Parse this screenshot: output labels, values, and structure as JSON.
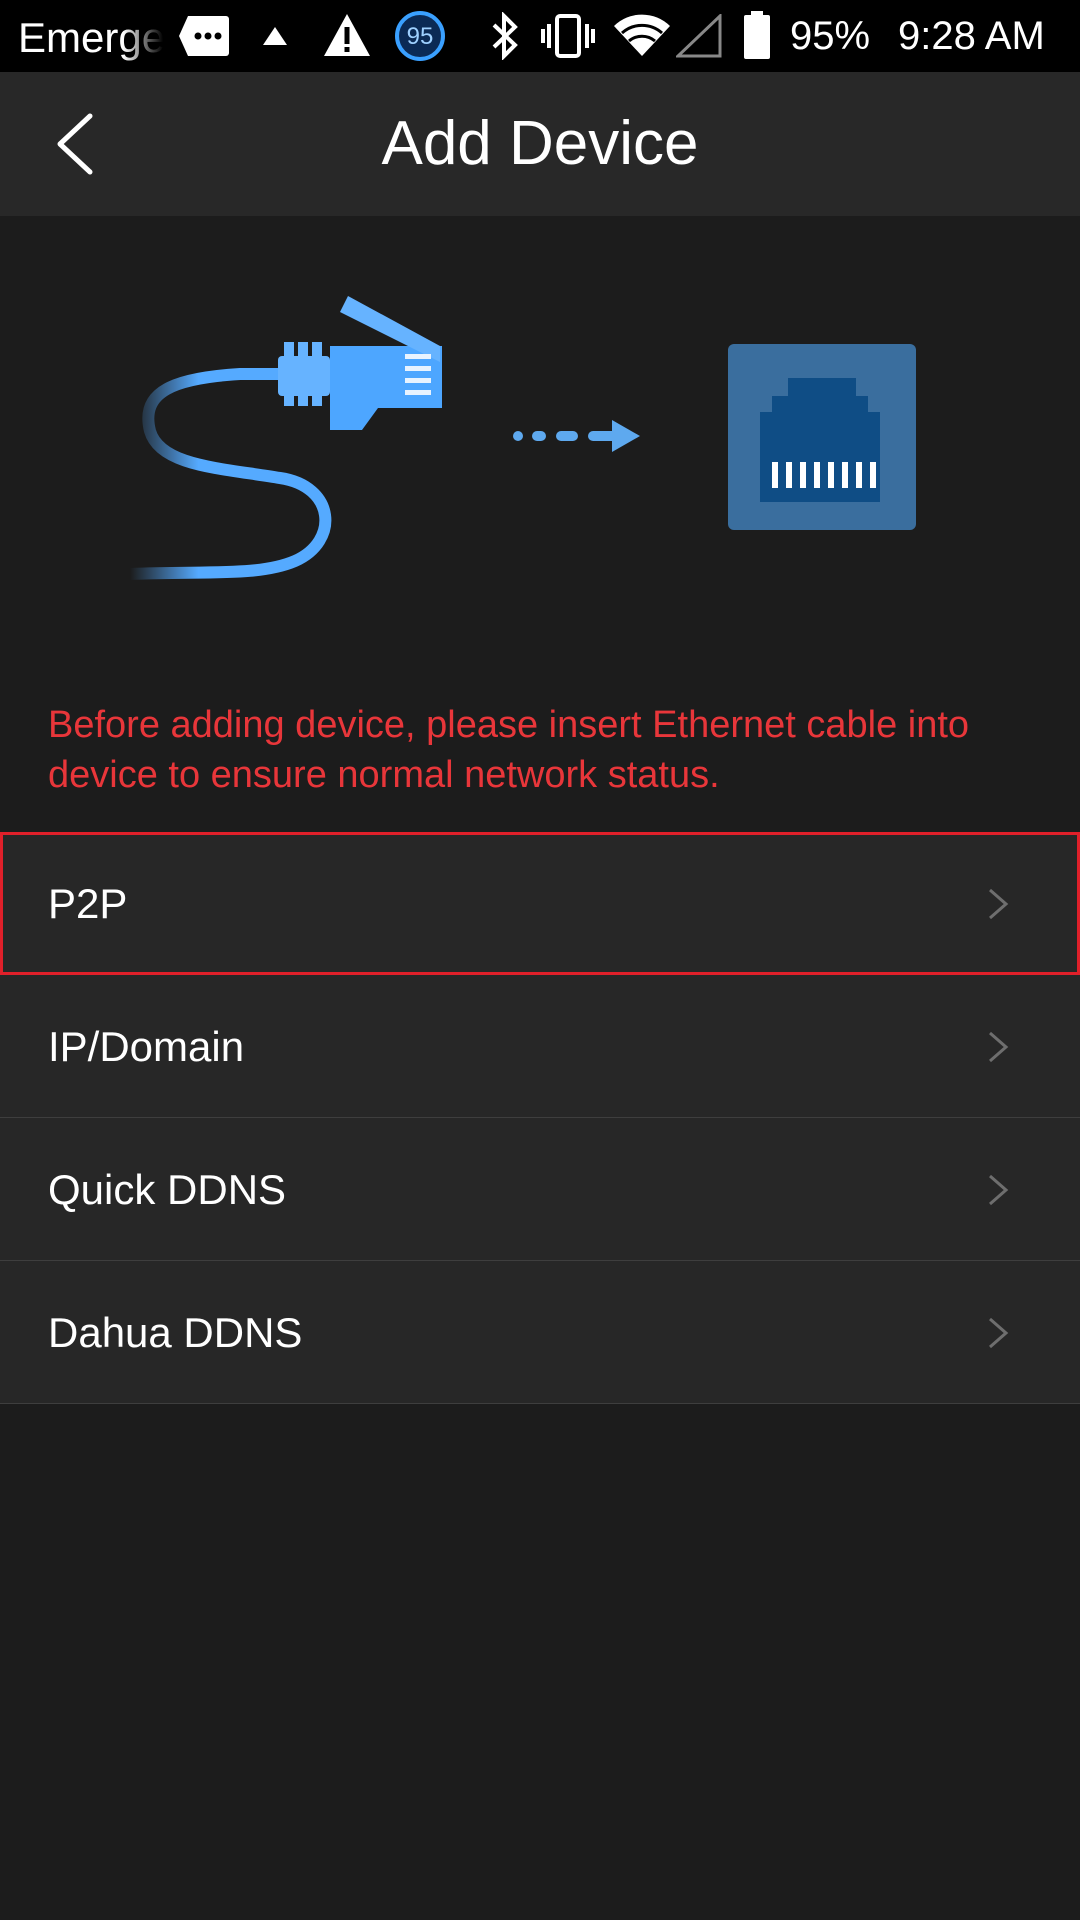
{
  "status_bar": {
    "carrier": "Emerge",
    "battery": "95%",
    "time": "9:28 AM",
    "badge_number": "95",
    "icons": [
      "message-icon",
      "upload-icon",
      "warning-icon",
      "badge-icon",
      "bluetooth-icon",
      "vibrate-icon",
      "wifi-icon",
      "signal-icon",
      "battery-icon"
    ]
  },
  "header": {
    "title": "Add Device",
    "back_icon": "back-arrow-icon"
  },
  "illustration": {
    "icons": [
      "ethernet-cable-icon",
      "arrow-right-icon",
      "ethernet-port-icon"
    ],
    "colors": {
      "cable": "#55aaff",
      "port_bg": "#3a6e9e",
      "port": "#0f4d85"
    }
  },
  "notice": "Before adding device, please insert Ethernet cable into device to ensure normal network status.",
  "menu": {
    "items": [
      {
        "label": "P2P",
        "highlighted": true
      },
      {
        "label": "IP/Domain",
        "highlighted": false
      },
      {
        "label": "Quick DDNS",
        "highlighted": false
      },
      {
        "label": "Dahua DDNS",
        "highlighted": false
      }
    ]
  },
  "colors": {
    "background": "#1c1c1c",
    "header": "#282828",
    "menu_item": "#272727",
    "notice": "#e8363a",
    "highlight_border": "#e0202a"
  }
}
